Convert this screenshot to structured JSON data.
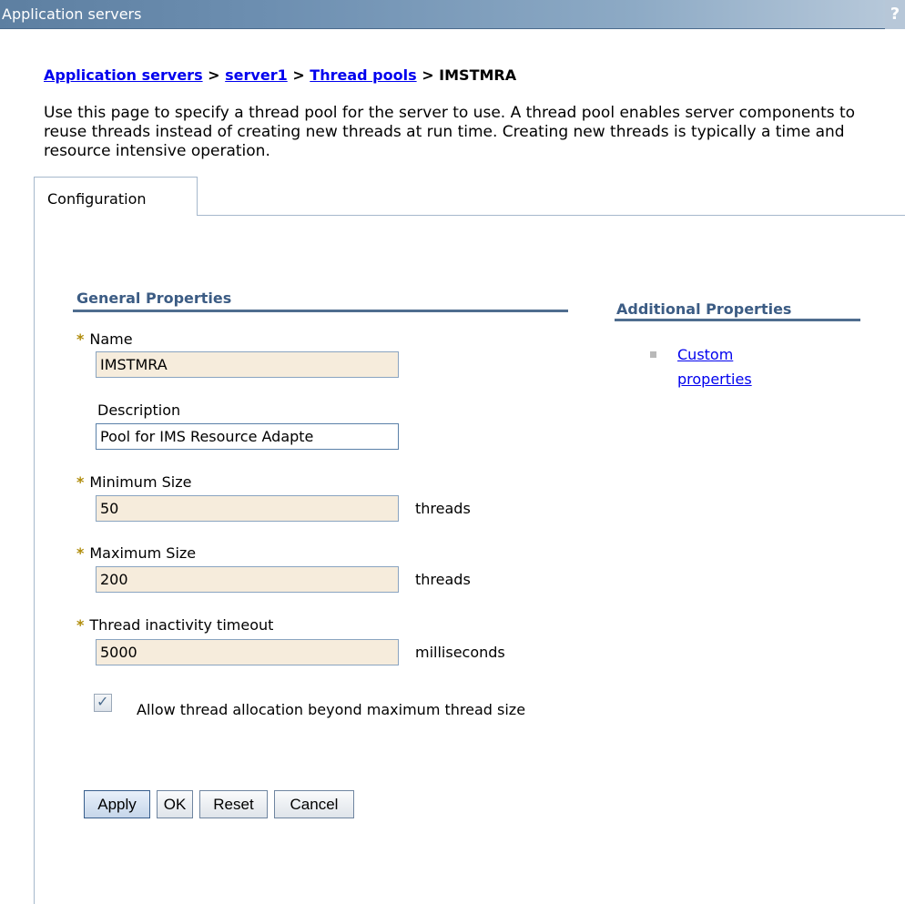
{
  "window": {
    "title": "Application servers",
    "help_label": "?"
  },
  "breadcrumb": {
    "items": [
      "Application servers",
      "server1",
      "Thread pools"
    ],
    "separator": ">",
    "current": "IMSTMRA"
  },
  "description": "Use this page to specify a thread pool for the server to use. A thread pool enables server components to reuse threads instead of creating new threads at run time. Creating new threads is typically a time and resource intensive operation.",
  "tabs": [
    {
      "label": "Configuration",
      "active": true
    }
  ],
  "general": {
    "heading": "General Properties",
    "required_marker": "*",
    "name": {
      "label": "Name",
      "value": "IMSTMRA",
      "required": true
    },
    "description": {
      "label": "Description",
      "value": "Pool for IMS Resource Adapte",
      "required": false
    },
    "min_size": {
      "label": "Minimum Size",
      "value": "50",
      "unit": "threads",
      "required": true
    },
    "max_size": {
      "label": "Maximum Size",
      "value": "200",
      "unit": "threads",
      "required": true
    },
    "timeout": {
      "label": "Thread inactivity timeout",
      "value": "5000",
      "unit": "milliseconds",
      "required": true
    },
    "allow_growth": {
      "label": "Allow thread allocation beyond maximum thread size",
      "checked": true
    }
  },
  "buttons": {
    "apply": "Apply",
    "ok": "OK",
    "reset": "Reset",
    "cancel": "Cancel"
  },
  "additional": {
    "heading": "Additional Properties",
    "links": [
      "Custom properties"
    ]
  },
  "colors": {
    "link": "#0000ee",
    "section_heading": "#3c5c84",
    "required_marker": "#b08c0a",
    "required_field_bg": "#f6ecdc"
  }
}
